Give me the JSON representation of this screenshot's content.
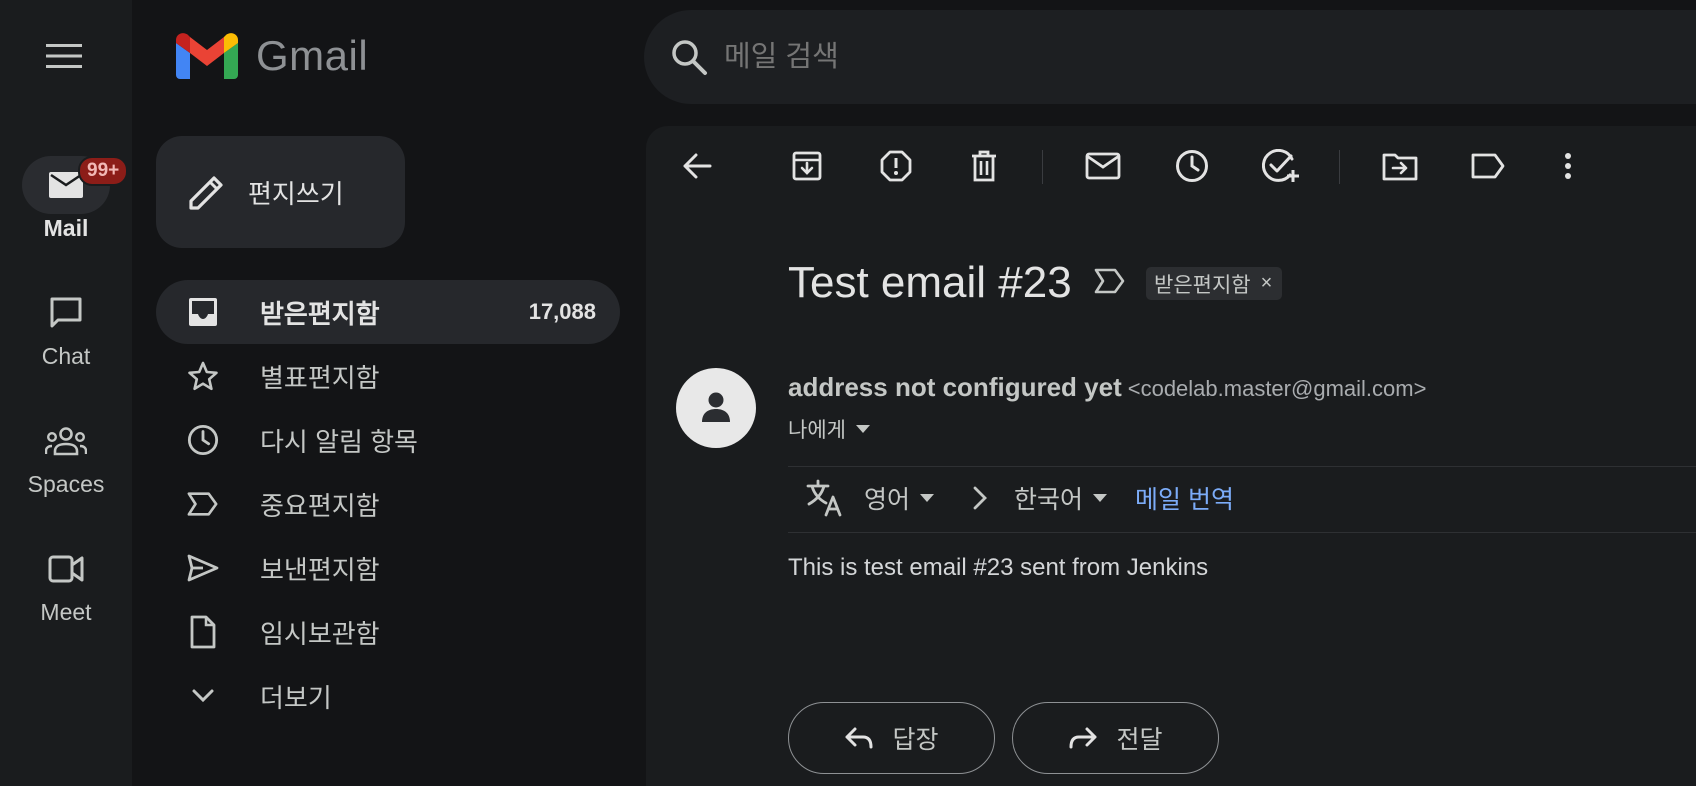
{
  "app": {
    "name": "Gmail"
  },
  "rail": {
    "items": [
      {
        "label": "Mail",
        "badge": "99+"
      },
      {
        "label": "Chat"
      },
      {
        "label": "Spaces"
      },
      {
        "label": "Meet"
      }
    ]
  },
  "search": {
    "placeholder": "메일 검색"
  },
  "compose": {
    "label": "편지쓰기"
  },
  "nav": {
    "items": [
      {
        "label": "받은편지함",
        "count": "17,088"
      },
      {
        "label": "별표편지함"
      },
      {
        "label": "다시 알림 항목"
      },
      {
        "label": "중요편지함"
      },
      {
        "label": "보낸편지함"
      },
      {
        "label": "임시보관함"
      },
      {
        "label": "더보기"
      }
    ]
  },
  "email": {
    "subject": "Test email #23",
    "label_chip": "받은편지함",
    "label_chip_close": "×",
    "sender_name": "address not configured yet",
    "sender_email": "<codelab.master@gmail.com>",
    "recipient": "나에게",
    "body": "This is test email #23 sent from Jenkins"
  },
  "translate": {
    "from_lang": "영어",
    "to_lang": "한국어",
    "action": "메일 번역"
  },
  "actions": {
    "reply": "답장",
    "forward": "전달"
  },
  "colors": {
    "background": "#131416",
    "panel": "#1a1c1e",
    "link": "#7cacf8",
    "badge_bg": "#8c1d18"
  }
}
